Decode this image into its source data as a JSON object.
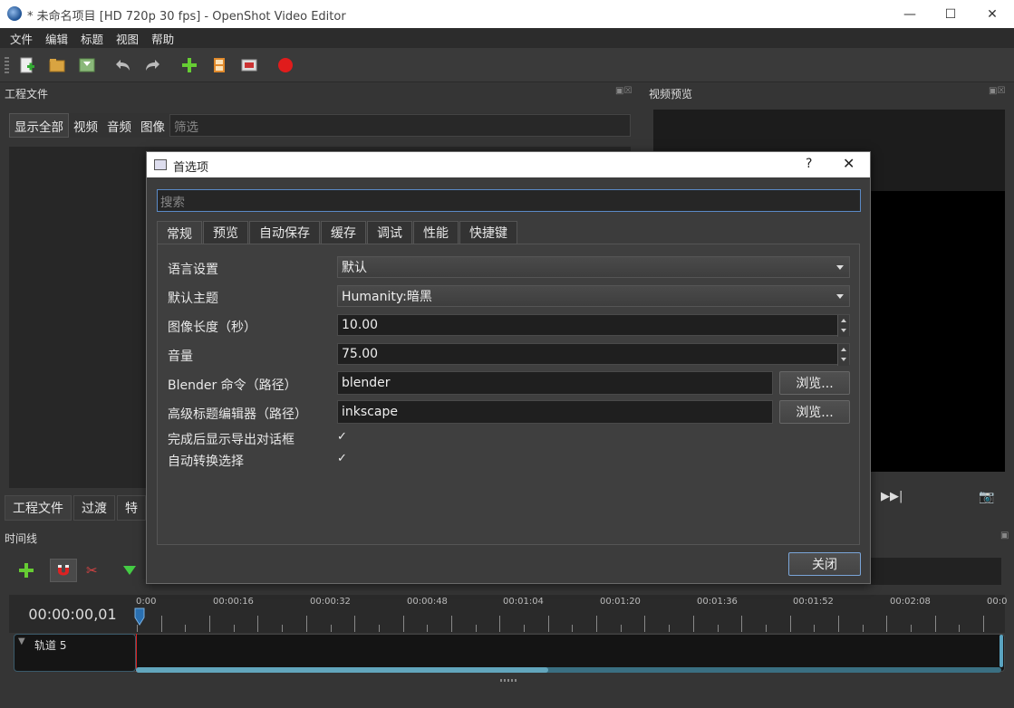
{
  "window": {
    "title": "* 未命名项目 [HD 720p 30 fps] - OpenShot Video Editor"
  },
  "menu": [
    "文件",
    "编辑",
    "标题",
    "视图",
    "帮助"
  ],
  "docks": {
    "project_files_title": "工程文件",
    "preview_title": "视频预览",
    "timeline_title": "时间线"
  },
  "filters": {
    "buttons": [
      "显示全部",
      "视频",
      "音频",
      "图像"
    ],
    "placeholder": "筛选"
  },
  "bottom_tabs": [
    "工程文件",
    "过渡",
    "特"
  ],
  "timeline": {
    "time": "00:00:00,01",
    "ticks": [
      "0:00",
      "00:00:16",
      "00:00:32",
      "00:00:48",
      "00:01:04",
      "00:01:20",
      "00:01:36",
      "00:01:52",
      "00:02:08",
      "00:0"
    ],
    "track_name": "轨道 5"
  },
  "dialog": {
    "title": "首选项",
    "help": "?",
    "search_placeholder": "搜索",
    "tabs": [
      "常规",
      "预览",
      "自动保存",
      "缓存",
      "调试",
      "性能",
      "快捷键"
    ],
    "rows": {
      "language_label": "语言设置",
      "language_value": "默认",
      "theme_label": "默认主题",
      "theme_value": "Humanity:暗黑",
      "image_len_label": "图像长度（秒）",
      "image_len_value": "10.00",
      "volume_label": "音量",
      "volume_value": "75.00",
      "blender_label": "Blender 命令（路径）",
      "blender_value": "blender",
      "title_editor_label": "高级标题编辑器（路径）",
      "title_editor_value": "inkscape",
      "browse_label": "浏览...",
      "export_dialog_label": "完成后显示导出对话框",
      "auto_transform_label": "自动转换选择",
      "check_mark": "✓"
    },
    "close_label": "关闭"
  }
}
